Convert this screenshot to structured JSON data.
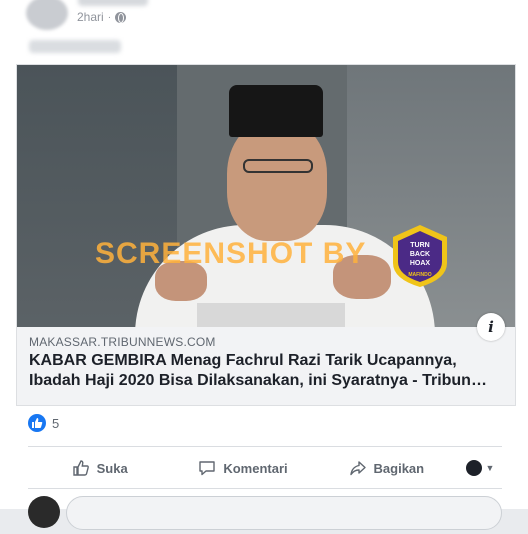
{
  "post": {
    "time": "2hari",
    "privacy_icon": "globe-icon"
  },
  "link": {
    "watermark": "SCREENSHOT BY",
    "badge": {
      "top_text": "TURN",
      "mid_text": "BACK",
      "bottom_text": "HOAX",
      "org": "MAFINDO",
      "ring_text": "MASYARAKAT ANTI FITNAH INDONESIA"
    },
    "domain": "MAKASSAR.TRIBUNNEWS.COM",
    "headline": "KABAR GEMBIRA Menag Fachrul Razi Tarik Ucapannya, Ibadah Haji 2020 Bisa Dilaksanakan, ini Syaratnya - Tribun…",
    "info_label": "i"
  },
  "reactions": {
    "count": "5",
    "icon": "like-reaction-icon"
  },
  "actions": {
    "like": "Suka",
    "comment": "Komentari",
    "share": "Bagikan"
  },
  "colors": {
    "accent": "#1877f2",
    "text_primary": "#1d2129",
    "text_secondary": "#606770",
    "watermark": "#ffb23c",
    "badge_purple": "#4b2a86",
    "badge_gold": "#f0c419"
  }
}
